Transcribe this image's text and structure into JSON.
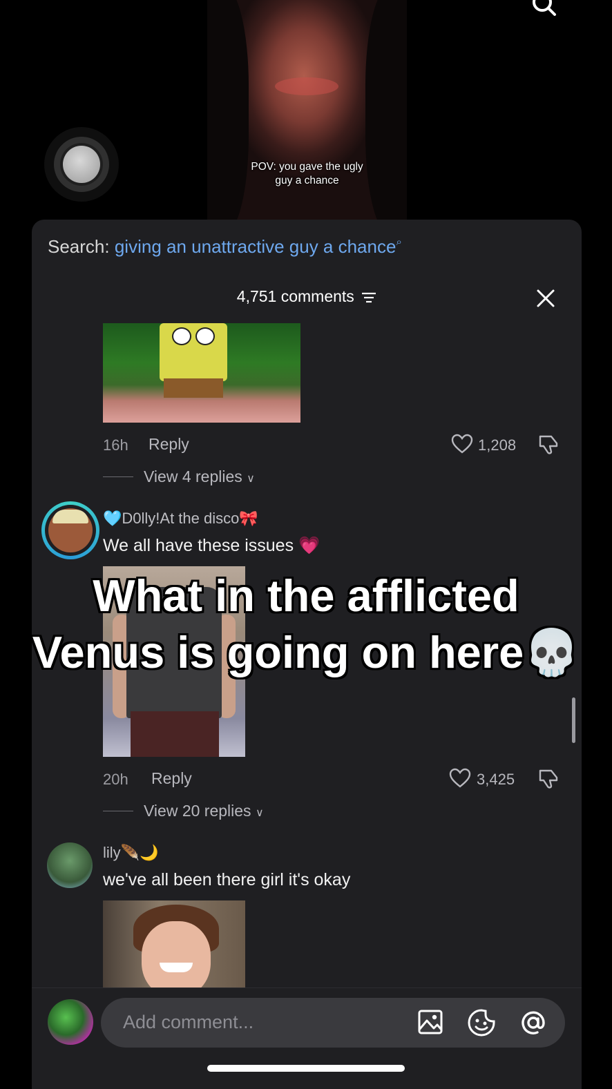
{
  "video": {
    "caption_line1": "POV: you gave the ugly",
    "caption_line2": "guy a chance"
  },
  "sheet": {
    "search_prefix": "Search:",
    "search_term": "giving an unattractive guy a chance",
    "comments_count": "4,751 comments",
    "close_icon": "close-icon",
    "filter_icon": "filter-icon"
  },
  "comments": [
    {
      "time": "16h",
      "reply_label": "Reply",
      "likes": "1,208",
      "view_replies": "View 4 replies",
      "image": "spongebob-gif"
    },
    {
      "username": "🩵D0lly!At the disco🎀",
      "text": "We all have these issues 💗",
      "time": "20h",
      "reply_label": "Reply",
      "likes": "3,425",
      "view_replies": "View 20 replies",
      "image": "man-in-shirt-photo"
    },
    {
      "username": "lily🪶🌙",
      "text": "we've all been there girl it's okay",
      "image": "smiling-boy-photo"
    }
  ],
  "overlay_caption": {
    "line1": "What in the afflicted",
    "line2": "Venus is going on here💀"
  },
  "input": {
    "placeholder": "Add comment...",
    "icons": [
      "image-icon",
      "sticker-icon",
      "mention-icon"
    ]
  },
  "colors": {
    "sheet_bg": "#1f1f22",
    "search_term": "#6ea8ee",
    "muted_text": "#9d9da3"
  }
}
